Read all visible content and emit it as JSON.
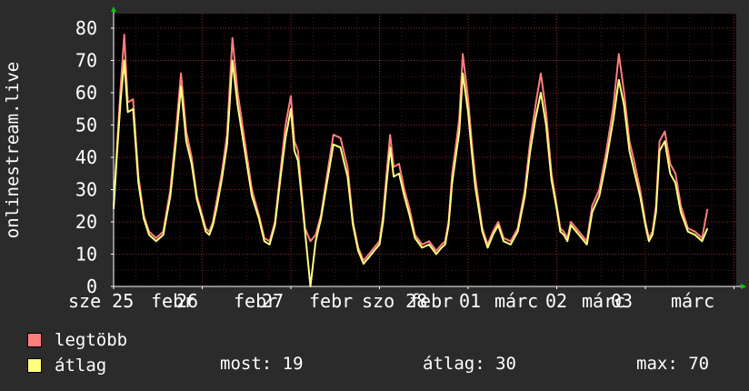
{
  "chart_data": {
    "type": "line",
    "ylabel": "onlinestream.live",
    "ylim": [
      0,
      85
    ],
    "yticks": [
      0,
      10,
      20,
      30,
      40,
      50,
      60,
      70,
      80
    ],
    "grid": true,
    "x_tick_labels": [
      "sze 25",
      "febr",
      "26",
      "febr",
      "27",
      "febr",
      "szo 28",
      "febr",
      "01",
      "márc",
      "02",
      "márc",
      "03",
      "márc"
    ],
    "x_tick_labels_rendered": [
      "sze 25 febr",
      "26 febr",
      "27 febr",
      "szo 28 febr",
      "01 márc",
      "02 márc",
      "03 márc"
    ],
    "x_days": [
      0,
      1,
      2,
      3,
      4,
      5,
      6
    ],
    "series": [
      {
        "name": "legtöbb",
        "color": "#ff7f7f",
        "x": [
          0.0,
          0.04,
          0.08,
          0.12,
          0.16,
          0.22,
          0.28,
          0.34,
          0.4,
          0.48,
          0.56,
          0.64,
          0.7,
          0.76,
          0.82,
          0.88,
          0.94,
          1.0,
          1.04,
          1.08,
          1.12,
          1.16,
          1.22,
          1.28,
          1.34,
          1.4,
          1.48,
          1.56,
          1.64,
          1.7,
          1.76,
          1.82,
          1.88,
          1.94,
          2.0,
          2.04,
          2.08,
          2.12,
          2.16,
          2.22,
          2.28,
          2.34,
          2.4,
          2.48,
          2.56,
          2.64,
          2.7,
          2.76,
          2.82,
          2.88,
          2.94,
          3.0,
          3.04,
          3.08,
          3.12,
          3.16,
          3.22,
          3.28,
          3.34,
          3.4,
          3.48,
          3.56,
          3.64,
          3.7,
          3.74,
          3.78,
          3.82,
          3.86,
          3.9,
          3.94,
          4.0,
          4.04,
          4.08,
          4.12,
          4.16,
          4.22,
          4.28,
          4.34,
          4.4,
          4.48,
          4.56,
          4.64,
          4.7,
          4.76,
          4.82,
          4.88,
          4.94,
          5.0,
          5.04,
          5.08,
          5.12,
          5.16,
          5.22,
          5.28,
          5.34,
          5.4,
          5.48,
          5.56,
          5.64,
          5.7,
          5.76,
          5.82,
          5.88,
          5.94,
          6.0,
          6.04,
          6.08,
          6.12,
          6.16,
          6.22,
          6.28,
          6.34,
          6.4,
          6.48,
          6.56,
          6.64,
          6.7
        ],
        "values": [
          25,
          44,
          62,
          78,
          57,
          58,
          34,
          22,
          17,
          15,
          17,
          30,
          47,
          66,
          48,
          40,
          28,
          22,
          18,
          17,
          20,
          26,
          35,
          47,
          77,
          60,
          45,
          30,
          22,
          15,
          14,
          20,
          35,
          50,
          59,
          45,
          42,
          30,
          18,
          14,
          16,
          22,
          33,
          47,
          46,
          37,
          20,
          12,
          8,
          10,
          12,
          14,
          22,
          35,
          47,
          37,
          38,
          30,
          24,
          16,
          13,
          14,
          11,
          13,
          14,
          20,
          35,
          43,
          52,
          72,
          58,
          45,
          34,
          26,
          18,
          13,
          17,
          20,
          15,
          14,
          18,
          30,
          45,
          56,
          66,
          54,
          35,
          25,
          18,
          17,
          15,
          20,
          18,
          16,
          14,
          25,
          30,
          42,
          56,
          72,
          60,
          45,
          38,
          30,
          20,
          15,
          17,
          25,
          45,
          48,
          38,
          35,
          25,
          18,
          17,
          15,
          24
        ]
      },
      {
        "name": "átlag",
        "color": "#ffff7f",
        "x": [
          0.0,
          0.04,
          0.08,
          0.12,
          0.16,
          0.22,
          0.28,
          0.34,
          0.4,
          0.48,
          0.56,
          0.64,
          0.7,
          0.76,
          0.82,
          0.88,
          0.94,
          1.0,
          1.04,
          1.08,
          1.12,
          1.16,
          1.22,
          1.28,
          1.34,
          1.4,
          1.48,
          1.56,
          1.64,
          1.7,
          1.76,
          1.82,
          1.88,
          1.94,
          2.0,
          2.04,
          2.08,
          2.12,
          2.16,
          2.22,
          2.28,
          2.34,
          2.4,
          2.48,
          2.56,
          2.64,
          2.7,
          2.76,
          2.82,
          2.88,
          2.94,
          3.0,
          3.04,
          3.08,
          3.12,
          3.16,
          3.22,
          3.28,
          3.34,
          3.4,
          3.48,
          3.56,
          3.64,
          3.7,
          3.74,
          3.78,
          3.82,
          3.86,
          3.9,
          3.94,
          4.0,
          4.04,
          4.08,
          4.12,
          4.16,
          4.22,
          4.28,
          4.34,
          4.4,
          4.48,
          4.56,
          4.64,
          4.7,
          4.76,
          4.82,
          4.88,
          4.94,
          5.0,
          5.04,
          5.08,
          5.12,
          5.16,
          5.22,
          5.28,
          5.34,
          5.4,
          5.48,
          5.56,
          5.64,
          5.7,
          5.76,
          5.82,
          5.88,
          5.94,
          6.0,
          6.04,
          6.08,
          6.12,
          6.16,
          6.22,
          6.28,
          6.34,
          6.4,
          6.48,
          6.56,
          6.64,
          6.7
        ],
        "values": [
          24,
          42,
          58,
          70,
          54,
          55,
          32,
          21,
          16,
          14,
          16,
          28,
          44,
          62,
          45,
          38,
          27,
          21,
          17,
          16,
          19,
          24,
          33,
          44,
          70,
          56,
          42,
          28,
          21,
          14,
          13,
          19,
          33,
          46,
          55,
          42,
          39,
          28,
          17,
          0,
          14,
          21,
          31,
          44,
          43,
          34,
          19,
          11,
          7,
          9,
          11,
          13,
          20,
          32,
          43,
          34,
          35,
          28,
          22,
          15,
          12,
          13,
          10,
          12,
          13,
          19,
          32,
          40,
          48,
          66,
          54,
          42,
          31,
          24,
          17,
          12,
          16,
          19,
          14,
          13,
          17,
          28,
          42,
          52,
          60,
          50,
          33,
          24,
          17,
          16,
          14,
          19,
          17,
          15,
          13,
          23,
          28,
          39,
          52,
          64,
          56,
          42,
          35,
          28,
          19,
          14,
          16,
          23,
          42,
          45,
          35,
          32,
          23,
          17,
          16,
          14,
          18
        ]
      }
    ]
  },
  "legend": {
    "items": [
      {
        "label": "legtöbb",
        "color": "#ff7f7f"
      },
      {
        "label": "átlag",
        "color": "#ffff7f"
      }
    ]
  },
  "stats": {
    "now": "most: 19",
    "avg": "átlag: 30",
    "max": "max: 70"
  },
  "colors": {
    "background": "#2b2b2b",
    "plot_background": "#000000",
    "grid": "#6b1f1f",
    "axis": "#ffffff",
    "arrow": "#00cc00"
  }
}
